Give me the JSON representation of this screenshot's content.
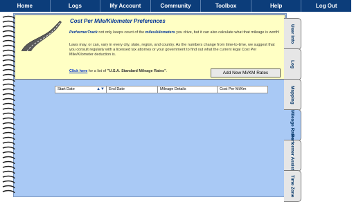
{
  "nav": {
    "items": [
      "Home",
      "Logs",
      "My Account",
      "Community",
      "Toolbox",
      "Help",
      "Log Out"
    ]
  },
  "preferences": {
    "title": "Cost Per Mile/Kilometer Preferences",
    "para1_brand": "PerformerTrack",
    "para1_pre": " not only keeps count of the ",
    "para1_highlight": "miles/kilometers",
    "para1_post": " you drive, but it can also calculate what that mileage is worth!",
    "para2": "Laws may, or can, vary in every city, state, region, and country. As the numbers change from time-to-time, we suggest that you consult regularly with a licensed tax attorney or your government to find out what the current legal Cost Per Mile/Kilometer deduction is.",
    "link_text": "Click here",
    "link_suffix": " for a list of ",
    "link_quote": "\"U.S.A. Standard Mileage Rates\"",
    "link_end": ".",
    "add_button": "Add New Mi/KM Rates"
  },
  "table": {
    "columns": [
      "Start Date",
      "End Date",
      "Mileage Details",
      "Cost Per Mi/Km"
    ]
  },
  "tabs": [
    {
      "label": "User Info",
      "active": false
    },
    {
      "label": "Log",
      "active": false
    },
    {
      "label": "Mapping",
      "active": false
    },
    {
      "label": "Mileage Rates",
      "active": true
    },
    {
      "label": "Performer Assistant",
      "active": false
    },
    {
      "label": "Time Zone",
      "active": false
    }
  ],
  "colors": {
    "nav_bg": "#0c3d7a",
    "notebook_bg": "#a9c9f5",
    "header_bg": "#ffffc4",
    "title_color": "#003399"
  }
}
